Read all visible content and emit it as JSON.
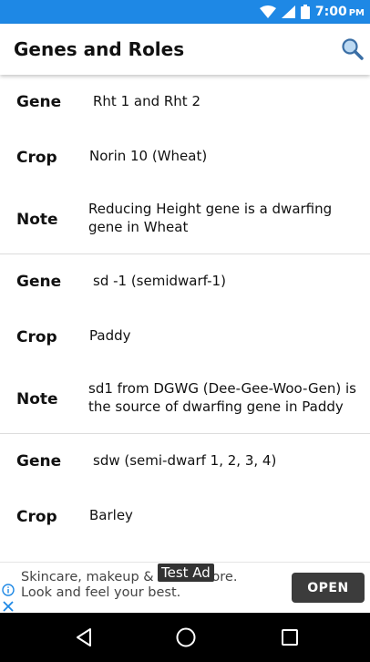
{
  "status_bar": {
    "time": "7:00",
    "ampm": "PM",
    "icons": [
      "wifi-icon",
      "signal-icon",
      "battery-icon"
    ]
  },
  "app_bar": {
    "title": "Genes and Roles",
    "search_icon": "search-icon"
  },
  "entries": [
    {
      "gene_label": "Gene",
      "gene": "Rht 1 and Rht 2",
      "crop_label": "Crop",
      "crop": "Norin 10 (Wheat)",
      "note_label": "Note",
      "note": "Reducing Height gene is a dwarfing gene in Wheat"
    },
    {
      "gene_label": "Gene",
      "gene": "sd -1 (semidwarf-1)",
      "crop_label": "Crop",
      "crop": "Paddy",
      "note_label": "Note",
      "note": "sd1 from DGWG (Dee-Gee-Woo-Gen) is the source of dwarfing gene in Paddy"
    },
    {
      "gene_label": "Gene",
      "gene": "sdw (semi-dwarf 1, 2, 3, 4)",
      "crop_label": "Crop",
      "crop": "Barley"
    }
  ],
  "ad": {
    "label": "Test Ad",
    "text": "Skincare, makeup & much more. Look and feel your best.",
    "button": "OPEN"
  },
  "nav_bar": {
    "icons": [
      "back-icon",
      "home-icon",
      "recents-icon"
    ]
  },
  "colors": {
    "status_bar": "#1e88e5",
    "divider": "#dcdcdc",
    "ad_button": "#3c3c3c",
    "nav_bar": "#000000"
  }
}
